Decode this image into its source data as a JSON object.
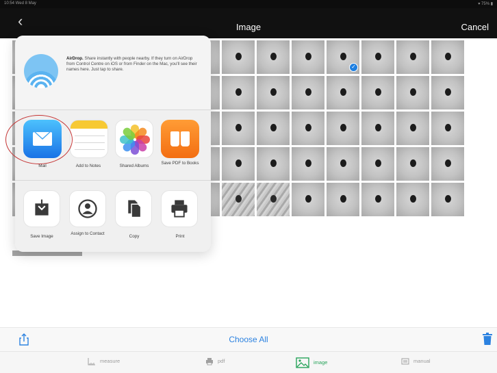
{
  "status_bar": {
    "left": "10:54  Wed 8 May",
    "right": "▾ 75% ▮"
  },
  "nav": {
    "back_glyph": "‹",
    "title": "Image",
    "cancel_label": "Cancel"
  },
  "airdrop": {
    "title": "AirDrop.",
    "description": "Share instantly with people nearby. If they turn on AirDrop from Control Centre on iOS or from Finder on the Mac, you'll see their names here. Just tap to share."
  },
  "share_apps": [
    {
      "label": "Mail",
      "icon": "mail-icon"
    },
    {
      "label": "Add to Notes",
      "icon": "notes-icon"
    },
    {
      "label": "Shared Albums",
      "icon": "photos-icon"
    },
    {
      "label": "Save PDF to Books",
      "icon": "books-icon"
    }
  ],
  "share_actions": [
    {
      "label": "Save Image",
      "icon": "save-image-icon"
    },
    {
      "label": "Assign to Contact",
      "icon": "contact-icon"
    },
    {
      "label": "Copy",
      "icon": "copy-icon"
    },
    {
      "label": "Print",
      "icon": "print-icon"
    }
  ],
  "toolbar": {
    "choose_all_label": "Choose All",
    "share_icon": "share-icon",
    "trash_icon": "trash-icon"
  },
  "tabs": [
    {
      "label": "measure",
      "icon": "ruler-icon",
      "active": false
    },
    {
      "label": "pdf",
      "icon": "printer-icon",
      "active": false
    },
    {
      "label": "image",
      "icon": "image-icon",
      "active": true
    },
    {
      "label": "manual",
      "icon": "book-icon",
      "active": false
    }
  ],
  "colors": {
    "accent": "#2c82e0",
    "active_tab": "#27a35a",
    "highlight_ring": "#c43030",
    "nav_bg": "#111111"
  }
}
